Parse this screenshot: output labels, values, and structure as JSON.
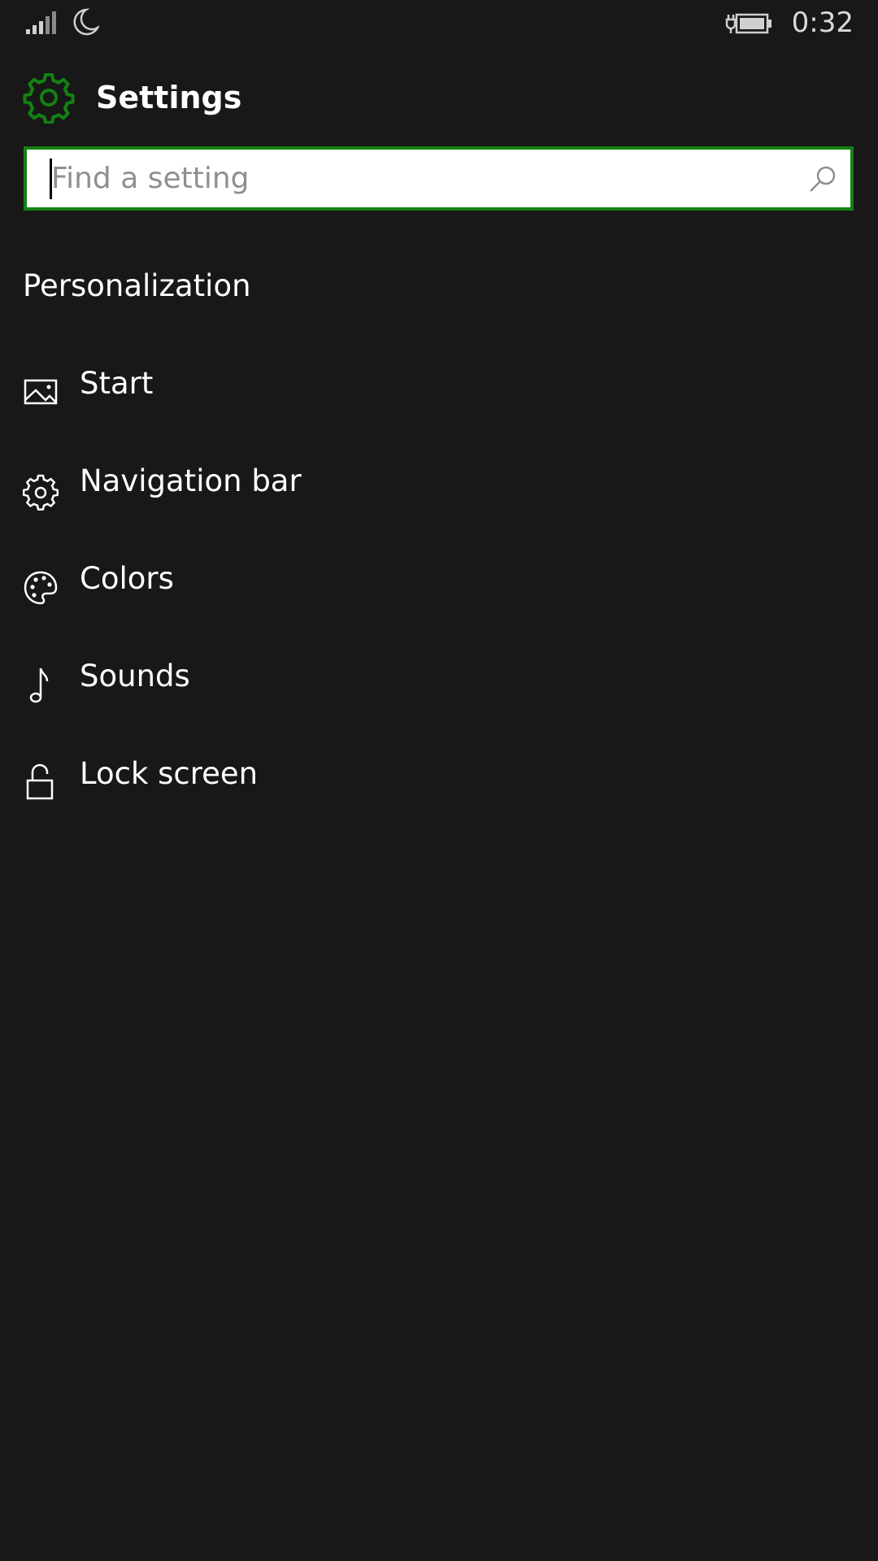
{
  "status_bar": {
    "time": "0:32",
    "icons": [
      "signal-icon",
      "moon-icon",
      "battery-charging-icon"
    ]
  },
  "header": {
    "title": "Settings",
    "icon": "gear-icon",
    "accent_color": "#128212"
  },
  "search": {
    "placeholder": "Find a setting",
    "value": "",
    "icon": "search-icon"
  },
  "section": {
    "title": "Personalization"
  },
  "menu": {
    "items": [
      {
        "label": "Start",
        "icon": "picture-icon"
      },
      {
        "label": "Navigation bar",
        "icon": "gear-icon"
      },
      {
        "label": "Colors",
        "icon": "palette-icon"
      },
      {
        "label": "Sounds",
        "icon": "music-note-icon"
      },
      {
        "label": "Lock screen",
        "icon": "lock-icon"
      }
    ]
  },
  "colors": {
    "background": "#181818",
    "accent": "#128212",
    "text": "#ffffff"
  }
}
